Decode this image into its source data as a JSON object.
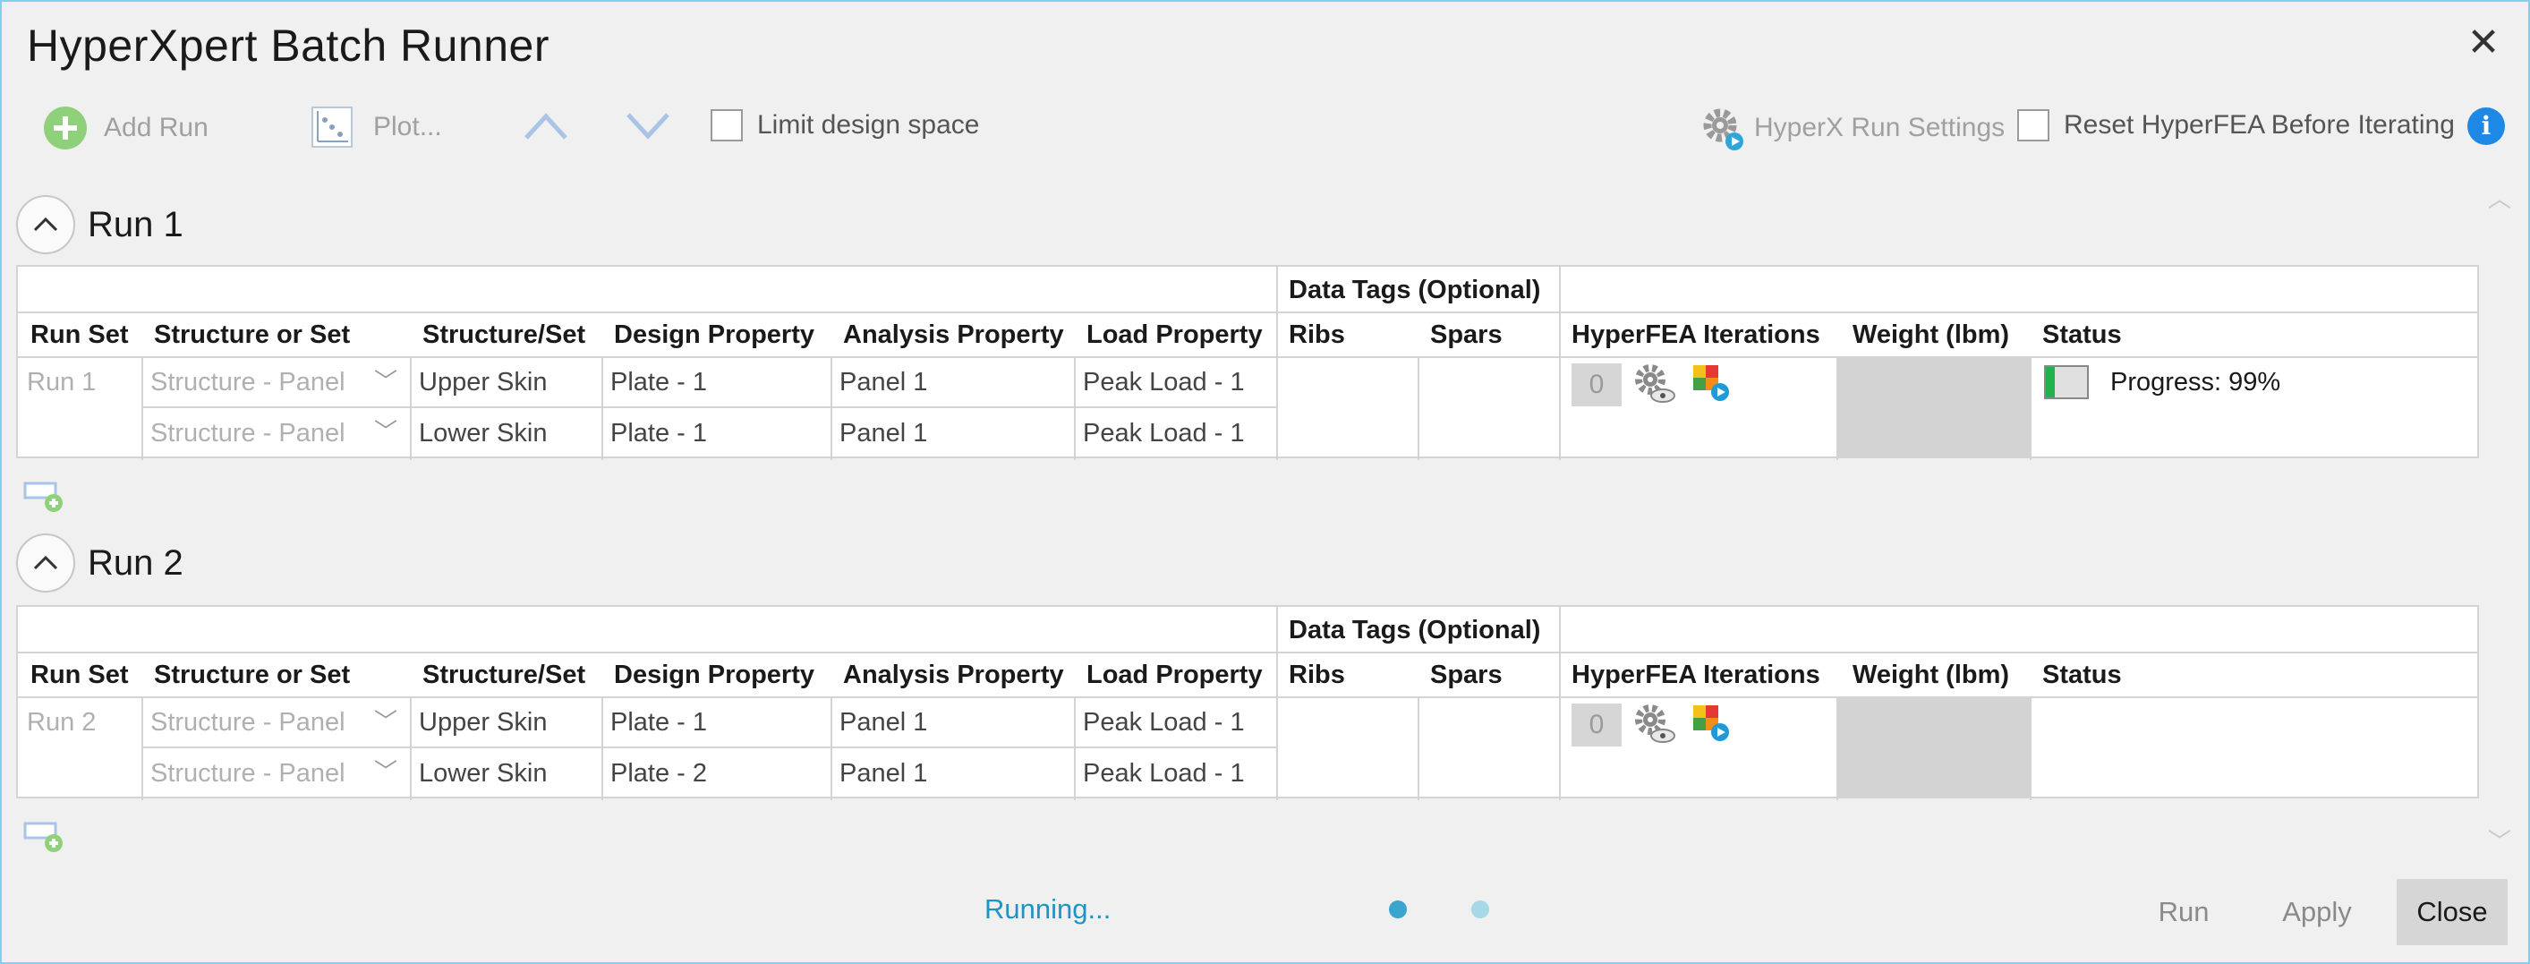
{
  "window": {
    "title": "HyperXpert Batch Runner"
  },
  "toolbar": {
    "add_run": "Add Run",
    "plot": "Plot...",
    "limit_design_space": "Limit design space",
    "run_settings": "HyperX Run Settings",
    "reset_hyperfea": "Reset HyperFEA Before Iterating"
  },
  "table_headers": {
    "group": "Data Tags (Optional)",
    "run_set": "Run Set",
    "structure_or_set": "Structure or Set",
    "structure_set": "Structure/Set",
    "design_property": "Design Property",
    "analysis_property": "Analysis Property",
    "load_property": "Load Property",
    "ribs": "Ribs",
    "spars": "Spars",
    "hyperfea_iterations": "HyperFEA Iterations",
    "weight": "Weight (lbm)",
    "status": "Status"
  },
  "runs": [
    {
      "title": "Run 1",
      "run_set": "Run 1",
      "iterations": "0",
      "status": "Progress: 99%",
      "progress": 0.99,
      "rows": [
        {
          "structure_or_set": "Structure - Panel",
          "structure": "Upper Skin",
          "design": "Plate - 1",
          "analysis": "Panel 1",
          "load": "Peak Load - 1"
        },
        {
          "structure_or_set": "Structure - Panel",
          "structure": "Lower Skin",
          "design": "Plate - 1",
          "analysis": "Panel 1",
          "load": "Peak Load - 1"
        }
      ]
    },
    {
      "title": "Run 2",
      "run_set": "Run 2",
      "iterations": "0",
      "status": "",
      "rows": [
        {
          "structure_or_set": "Structure - Panel",
          "structure": "Upper Skin",
          "design": "Plate - 1",
          "analysis": "Panel 1",
          "load": "Peak Load - 1"
        },
        {
          "structure_or_set": "Structure - Panel",
          "structure": "Lower Skin",
          "design": "Plate - 2",
          "analysis": "Panel 1",
          "load": "Peak Load - 1"
        }
      ]
    }
  ],
  "footer": {
    "status": "Running...",
    "run": "Run",
    "apply": "Apply",
    "close": "Close"
  },
  "colors": {
    "accent": "#1b95c4",
    "window_border": "#7ad4ec",
    "progress": "#22b24c"
  }
}
